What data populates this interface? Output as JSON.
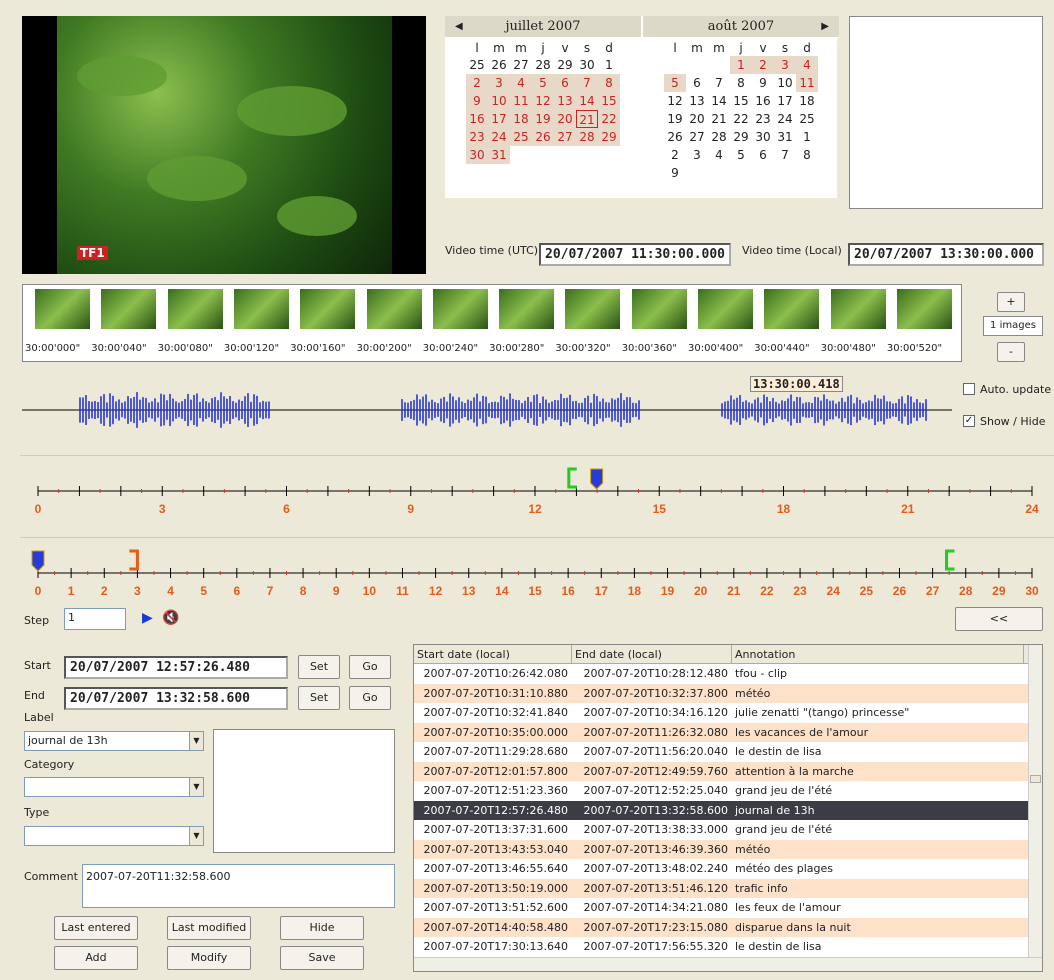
{
  "calendar": {
    "prev_icon": "left-arrow-icon",
    "next_icon": "right-arrow-icon",
    "months": [
      {
        "title": "juillet 2007",
        "dow": [
          "l",
          "m",
          "m",
          "j",
          "v",
          "s",
          "d"
        ],
        "days": [
          "25",
          "26",
          "27",
          "28",
          "29",
          "30",
          "1",
          "2",
          "3",
          "4",
          "5",
          "6",
          "7",
          "8",
          "9",
          "10",
          "11",
          "12",
          "13",
          "14",
          "15",
          "16",
          "17",
          "18",
          "19",
          "20",
          "21",
          "22",
          "23",
          "24",
          "25",
          "26",
          "27",
          "28",
          "29",
          "30",
          "31",
          "",
          "",
          "",
          "",
          ""
        ]
      },
      {
        "title": "août 2007",
        "dow": [
          "l",
          "m",
          "m",
          "j",
          "v",
          "s",
          "d"
        ],
        "days": [
          "",
          "",
          "",
          "1",
          "2",
          "3",
          "4",
          "5",
          "6",
          "7",
          "8",
          "9",
          "10",
          "11",
          "12",
          "13",
          "14",
          "15",
          "16",
          "17",
          "18",
          "19",
          "20",
          "21",
          "22",
          "23",
          "24",
          "25",
          "26",
          "27",
          "28",
          "29",
          "30",
          "31",
          "1",
          "2",
          "3",
          "4",
          "5",
          "6",
          "7",
          "8",
          "9"
        ]
      }
    ]
  },
  "video_time": {
    "utc_label": "Video time (UTC)",
    "utc_value": "20/07/2007 11:30:00.000",
    "local_label": "Video time (Local)",
    "local_value": "20/07/2007 13:30:00.000"
  },
  "video": {
    "logo": "TF1"
  },
  "thumbs": [
    "30:00'000\"",
    "30:00'040\"",
    "30:00'080\"",
    "30:00'120\"",
    "30:00'160\"",
    "30:00'200\"",
    "30:00'240\"",
    "30:00'280\"",
    "30:00'320\"",
    "30:00'360\"",
    "30:00'400\"",
    "30:00'440\"",
    "30:00'480\"",
    "30:00'520\""
  ],
  "zoom": {
    "plus": "+",
    "images": "1 images",
    "minus": "-"
  },
  "waveform": {
    "timecode": "13:30:00.418"
  },
  "options": {
    "auto_update": "Auto. update",
    "show_hide": "Show / Hide"
  },
  "timeline_hours": [
    "0",
    "3",
    "6",
    "9",
    "12",
    "15",
    "18",
    "21",
    "24"
  ],
  "timeline_minutes": [
    "0",
    "1",
    "2",
    "3",
    "4",
    "5",
    "6",
    "7",
    "8",
    "9",
    "10",
    "11",
    "12",
    "13",
    "14",
    "15",
    "16",
    "17",
    "18",
    "19",
    "20",
    "21",
    "22",
    "23",
    "24",
    "25",
    "26",
    "27",
    "28",
    "29",
    "30"
  ],
  "step": {
    "label": "Step",
    "value": "1",
    "collapse": "<<"
  },
  "form": {
    "start_label": "Start",
    "start_value": "20/07/2007 12:57:26.480",
    "end_label": "End",
    "end_value": "20/07/2007 13:32:58.600",
    "set": "Set",
    "go": "Go",
    "label_label": "Label",
    "label_value": "journal de 13h",
    "category_label": "Category",
    "type_label": "Type",
    "comment_label": "Comment",
    "comment_value": "2007-07-20T11:32:58.600",
    "last_entered": "Last entered",
    "last_modified": "Last modified",
    "hide": "Hide",
    "add": "Add",
    "modify": "Modify",
    "save": "Save"
  },
  "table": {
    "headers": [
      "Start date (local)",
      "End date (local)",
      "Annotation"
    ],
    "rows": [
      [
        "2007-07-20T10:26:42.080",
        "2007-07-20T10:28:12.480",
        "tfou - clip"
      ],
      [
        "2007-07-20T10:31:10.880",
        "2007-07-20T10:32:37.800",
        "météo"
      ],
      [
        "2007-07-20T10:32:41.840",
        "2007-07-20T10:34:16.120",
        "julie zenatti \"(tango) princesse\""
      ],
      [
        "2007-07-20T10:35:00.000",
        "2007-07-20T11:26:32.080",
        "les vacances de l'amour"
      ],
      [
        "2007-07-20T11:29:28.680",
        "2007-07-20T11:56:20.040",
        "le destin de lisa"
      ],
      [
        "2007-07-20T12:01:57.800",
        "2007-07-20T12:49:59.760",
        "attention à la marche"
      ],
      [
        "2007-07-20T12:51:23.360",
        "2007-07-20T12:52:25.040",
        "grand jeu de l'été"
      ],
      [
        "2007-07-20T12:57:26.480",
        "2007-07-20T13:32:58.600",
        "journal de 13h"
      ],
      [
        "2007-07-20T13:37:31.600",
        "2007-07-20T13:38:33.000",
        "grand jeu de l'été"
      ],
      [
        "2007-07-20T13:43:53.040",
        "2007-07-20T13:46:39.360",
        "météo"
      ],
      [
        "2007-07-20T13:46:55.640",
        "2007-07-20T13:48:02.240",
        "météo des plages"
      ],
      [
        "2007-07-20T13:50:19.000",
        "2007-07-20T13:51:46.120",
        "trafic info"
      ],
      [
        "2007-07-20T13:51:52.600",
        "2007-07-20T14:34:21.080",
        "les feux de l'amour"
      ],
      [
        "2007-07-20T14:40:58.480",
        "2007-07-20T17:23:15.080",
        "disparue dans la nuit"
      ],
      [
        "2007-07-20T17:30:13.640",
        "2007-07-20T17:56:55.320",
        "le destin de lisa"
      ]
    ]
  }
}
